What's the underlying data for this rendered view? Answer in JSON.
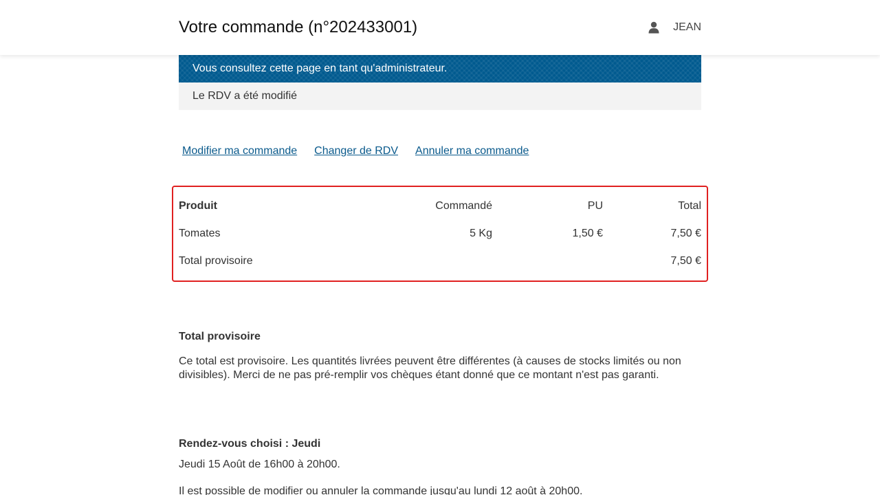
{
  "header": {
    "title": "Votre commande (n°202433001)",
    "user_icon": "user-icon",
    "user_name": "JEAN"
  },
  "banners": {
    "admin": "Vous consultez cette page en tant qu'administrateur.",
    "info": "Le RDV a été modifié"
  },
  "actions": [
    {
      "label": "Modifier ma commande"
    },
    {
      "label": "Changer de RDV"
    },
    {
      "label": "Annuler ma commande"
    }
  ],
  "order_table": {
    "headers": {
      "produit": "Produit",
      "commande": "Commandé",
      "pu": "PU",
      "total": "Total"
    },
    "rows": [
      {
        "produit": "Tomates",
        "commande": "5 Kg",
        "pu": "1,50 €",
        "total": "7,50 €"
      }
    ],
    "footer": {
      "label": "Total provisoire",
      "total": "7,50 €"
    }
  },
  "total_section": {
    "title": "Total provisoire",
    "text": "Ce total est provisoire. Les quantités livrées peuvent être différentes (à causes de stocks limités ou non divisibles). Merci de ne pas pré-remplir vos chèques étant donné que ce montant n'est pas garanti."
  },
  "rdv_section": {
    "title": "Rendez-vous choisi : Jeudi",
    "date_text": "Jeudi 15 Août de 16h00 à 20h00.",
    "deadline_text": "Il est possible de modifier ou annuler la commande jusqu'au lundi 12 août à 20h00."
  },
  "colors": {
    "admin_banner": "#005a8f",
    "info_banner": "#f3f3f3",
    "link": "#0a5a8c",
    "highlight_border": "#e02020"
  }
}
